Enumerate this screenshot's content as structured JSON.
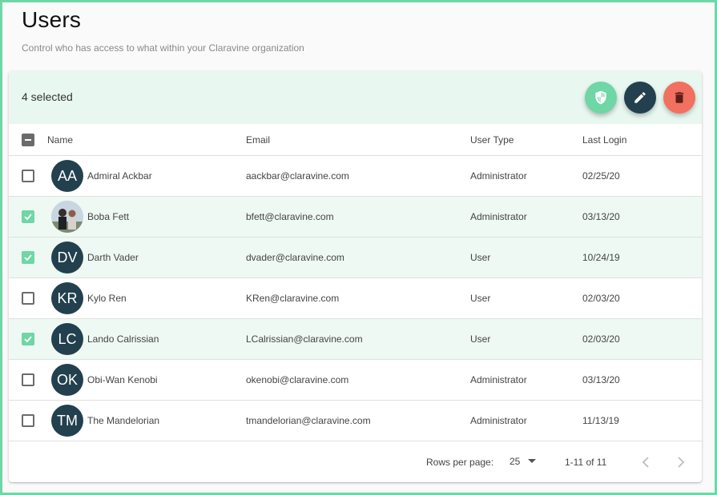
{
  "page": {
    "title": "Users",
    "subtitle": "Control who has access to what within your Claravine organization"
  },
  "toolbar": {
    "selected_text": "4 selected",
    "actions": [
      {
        "icon": "shield-icon",
        "color": "#6fd6a6"
      },
      {
        "icon": "edit-icon",
        "color": "#22404d"
      },
      {
        "icon": "delete-icon",
        "color": "#f1705f"
      }
    ]
  },
  "table": {
    "columns": {
      "name": "Name",
      "email": "Email",
      "user_type": "User Type",
      "last_login": "Last Login"
    },
    "select_all_state": "indeterminate",
    "rows": [
      {
        "initials": "AA",
        "name": "Admiral Ackbar",
        "email": "aackbar@claravine.com",
        "user_type": "Administrator",
        "last_login": "02/25/20",
        "selected": false,
        "avatar": "initials"
      },
      {
        "initials": "",
        "name": "Boba Fett",
        "email": "bfett@claravine.com",
        "user_type": "Administrator",
        "last_login": "03/13/20",
        "selected": true,
        "avatar": "photo"
      },
      {
        "initials": "DV",
        "name": "Darth Vader",
        "email": "dvader@claravine.com",
        "user_type": "User",
        "last_login": "10/24/19",
        "selected": true,
        "avatar": "initials"
      },
      {
        "initials": "KR",
        "name": "Kylo Ren",
        "email": "KRen@claravine.com",
        "user_type": "User",
        "last_login": "02/03/20",
        "selected": false,
        "avatar": "initials"
      },
      {
        "initials": "LC",
        "name": "Lando Calrissian",
        "email": "LCalrissian@claravine.com",
        "user_type": "User",
        "last_login": "02/03/20",
        "selected": true,
        "avatar": "initials"
      },
      {
        "initials": "OK",
        "name": "Obi-Wan Kenobi",
        "email": "okenobi@claravine.com",
        "user_type": "Administrator",
        "last_login": "03/13/20",
        "selected": false,
        "avatar": "initials"
      },
      {
        "initials": "TM",
        "name": "The Mandelorian",
        "email": "tmandelorian@claravine.com",
        "user_type": "Administrator",
        "last_login": "11/13/19",
        "selected": false,
        "avatar": "initials"
      }
    ]
  },
  "pagination": {
    "rows_per_page_label": "Rows per page:",
    "rows_per_page_value": "25",
    "range_text": "1-11 of 11"
  },
  "colors": {
    "accent": "#6fd6a6",
    "dark": "#22404d",
    "danger": "#f1705f",
    "selected_row": "#eef9f3"
  }
}
